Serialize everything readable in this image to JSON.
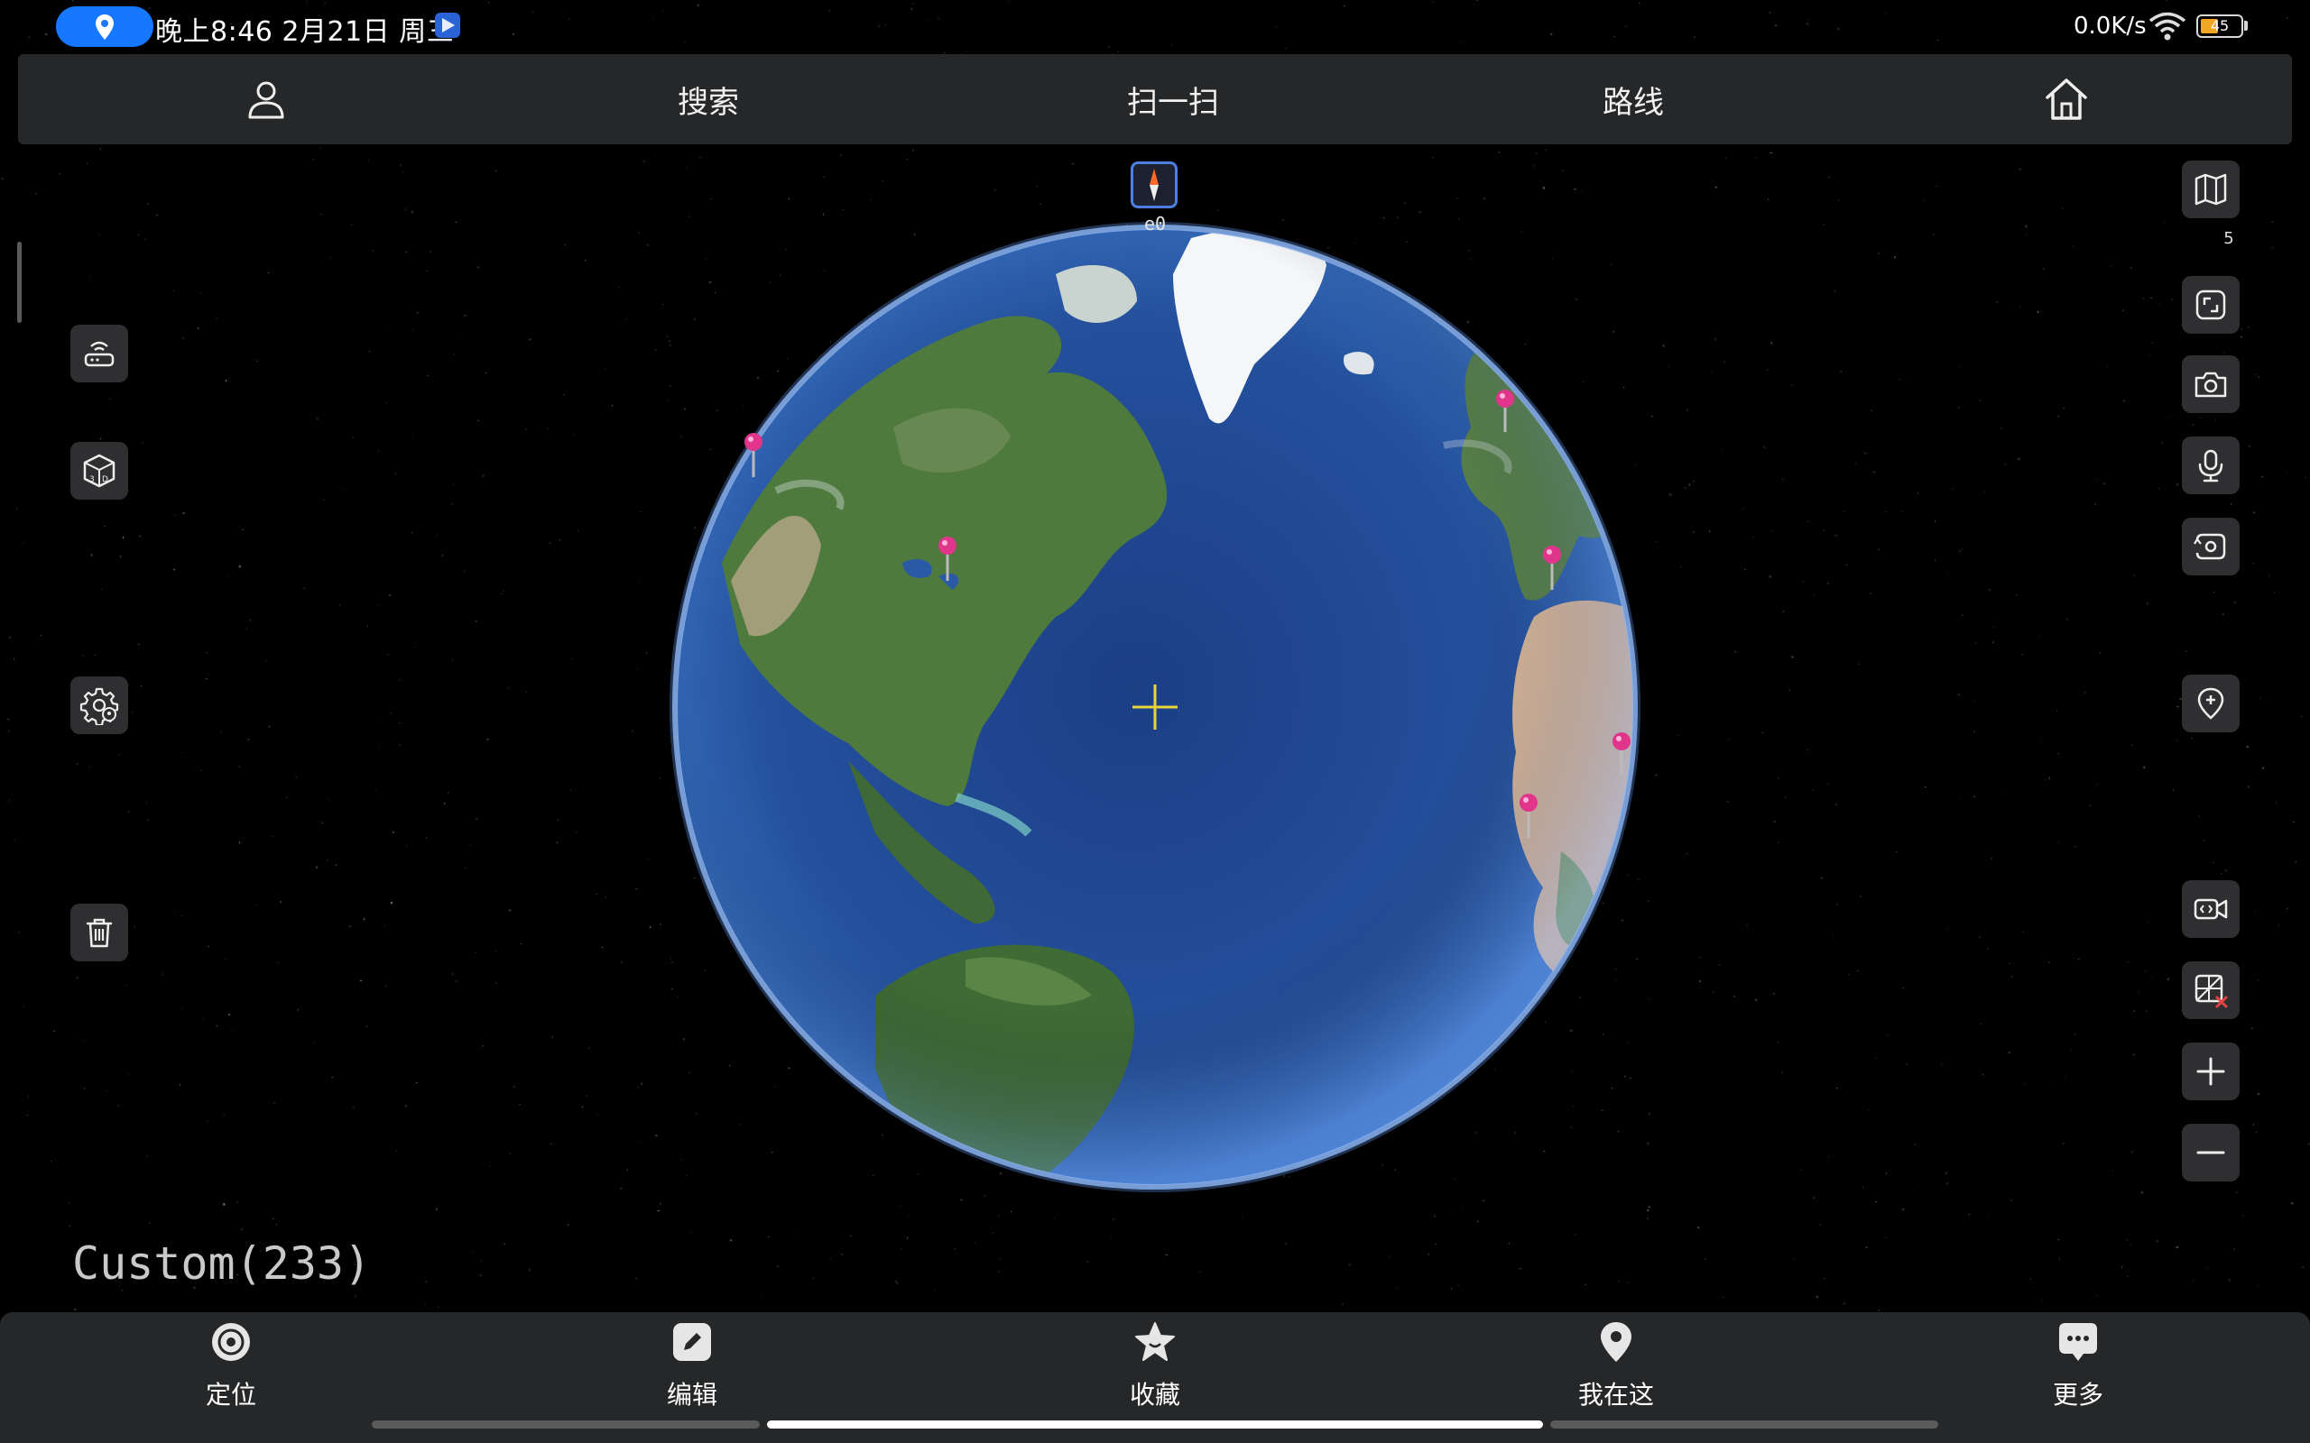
{
  "status_bar": {
    "time": "晚上8:46 2月21日 周三",
    "net_speed": "0.0K/s",
    "battery": {
      "text": "45",
      "level": 0.45,
      "color": "#f0a623"
    }
  },
  "top_bar": {
    "search": "搜索",
    "scan": "扫一扫",
    "route": "路线"
  },
  "right_panel": {
    "layer_count": "5"
  },
  "compass": {
    "label": "e0"
  },
  "globe": {
    "layer_name": "Custom(233)"
  },
  "bottom_nav": [
    {
      "label": "定位",
      "icon": "locate-icon"
    },
    {
      "label": "编辑",
      "icon": "edit-icon"
    },
    {
      "label": "收藏",
      "icon": "star-icon"
    },
    {
      "label": "我在这",
      "icon": "pin-icon"
    },
    {
      "label": "更多",
      "icon": "more-icon"
    }
  ],
  "colors": {
    "accent": "#1677ff",
    "toolbar_bg": "#262728",
    "button_bg": "#2f2f31",
    "ocean": "#234f9c",
    "marker": "#e0358a",
    "crosshair": "#e8d53a"
  }
}
